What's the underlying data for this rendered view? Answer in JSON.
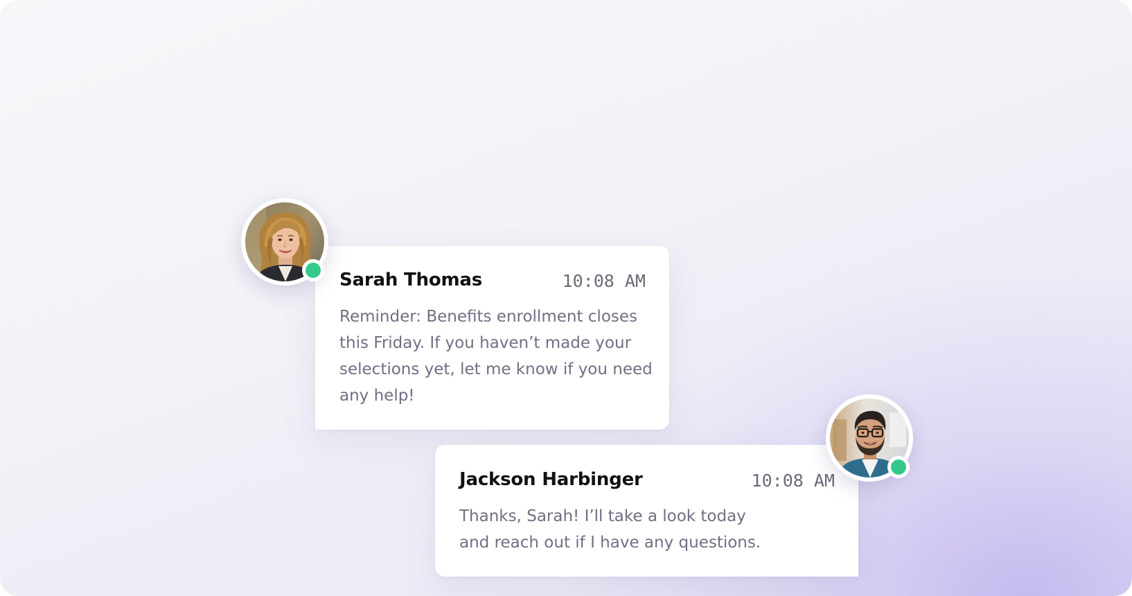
{
  "theme": {
    "status_online_color": "#34c98b",
    "card_background": "#ffffff",
    "name_color": "#111114",
    "message_color": "#6e7084",
    "time_color": "#6b6b78"
  },
  "messages": [
    {
      "sender": "Sarah Thomas",
      "time": "10:08 AM",
      "text": "Reminder: Benefits enrollment closes this Friday. If you haven’t made your selections yet, let me know if you need any help!",
      "avatar_icon": "woman-avatar",
      "status": "online"
    },
    {
      "sender": "Jackson Harbinger",
      "time": "10:08 AM",
      "text": "Thanks, Sarah! I’ll take a look today and reach out if I have any questions.",
      "avatar_icon": "man-avatar",
      "status": "online"
    }
  ]
}
